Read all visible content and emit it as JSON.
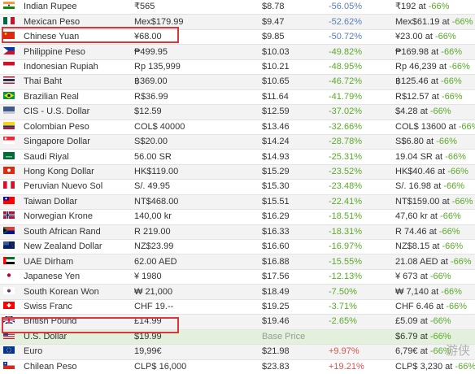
{
  "rows": [
    {
      "flag": "india",
      "name": "Indian Rupee",
      "price": "₹565",
      "converted": "$8.78",
      "diff": "-56.05%",
      "diff_type": "neg",
      "sale_price": "₹192",
      "sale_suffix": "at",
      "sale_pct": "-66%"
    },
    {
      "flag": "mexico",
      "name": "Mexican Peso",
      "price": "Mex$179.99",
      "converted": "$9.47",
      "diff": "-52.62%",
      "diff_type": "neg",
      "sale_price": "Mex$61.19",
      "sale_suffix": "at",
      "sale_pct": "-66%"
    },
    {
      "flag": "china",
      "name": "Chinese Yuan",
      "price": "¥68.00",
      "converted": "$9.85",
      "diff": "-50.72%",
      "diff_type": "neg",
      "sale_price": "¥23.00",
      "sale_suffix": "at",
      "sale_pct": "-66%"
    },
    {
      "flag": "philippines",
      "name": "Philippine Peso",
      "price": "₱499.95",
      "converted": "$10.03",
      "diff": "-49.82%",
      "diff_type": "green",
      "sale_price": "₱169.98",
      "sale_suffix": "at",
      "sale_pct": "-66%"
    },
    {
      "flag": "indonesia",
      "name": "Indonesian Rupiah",
      "price": "Rp 135,999",
      "converted": "$10.21",
      "diff": "-48.95%",
      "diff_type": "green",
      "sale_price": "Rp 46,239",
      "sale_suffix": "at",
      "sale_pct": "-66%"
    },
    {
      "flag": "thailand",
      "name": "Thai Baht",
      "price": "฿369.00",
      "converted": "$10.65",
      "diff": "-46.72%",
      "diff_type": "green",
      "sale_price": "฿125.46",
      "sale_suffix": "at",
      "sale_pct": "-66%"
    },
    {
      "flag": "brazil",
      "name": "Brazilian Real",
      "price": "R$36.99",
      "converted": "$11.64",
      "diff": "-41.79%",
      "diff_type": "green",
      "sale_price": "R$12.57",
      "sale_suffix": "at",
      "sale_pct": "-66%"
    },
    {
      "flag": "cis",
      "name": "CIS - U.S. Dollar",
      "price": "$12.59",
      "converted": "$12.59",
      "diff": "-37.02%",
      "diff_type": "green",
      "sale_price": "$4.28",
      "sale_suffix": "at",
      "sale_pct": "-66%"
    },
    {
      "flag": "colombia",
      "name": "Colombian Peso",
      "price": "COL$ 40000",
      "converted": "$13.46",
      "diff": "-32.66%",
      "diff_type": "green",
      "sale_price": "COL$ 13600",
      "sale_suffix": "at",
      "sale_pct": "-66%"
    },
    {
      "flag": "singapore",
      "name": "Singapore Dollar",
      "price": "S$20.00",
      "converted": "$14.24",
      "diff": "-28.78%",
      "diff_type": "green",
      "sale_price": "S$6.80",
      "sale_suffix": "at",
      "sale_pct": "-66%"
    },
    {
      "flag": "saudi",
      "name": "Saudi Riyal",
      "price": "56.00 SR",
      "converted": "$14.93",
      "diff": "-25.31%",
      "diff_type": "green",
      "sale_price": "19.04 SR",
      "sale_suffix": "at",
      "sale_pct": "-66%"
    },
    {
      "flag": "hongkong",
      "name": "Hong Kong Dollar",
      "price": "HK$119.00",
      "converted": "$15.29",
      "diff": "-23.52%",
      "diff_type": "green",
      "sale_price": "HK$40.46",
      "sale_suffix": "at",
      "sale_pct": "-66%"
    },
    {
      "flag": "peru",
      "name": "Peruvian Nuevo Sol",
      "price": "S/. 49.95",
      "converted": "$15.30",
      "diff": "-23.48%",
      "diff_type": "green",
      "sale_price": "S/. 16.98",
      "sale_suffix": "at",
      "sale_pct": "-66%"
    },
    {
      "flag": "taiwan",
      "name": "Taiwan Dollar",
      "price": "NT$468.00",
      "converted": "$15.51",
      "diff": "-22.41%",
      "diff_type": "green",
      "sale_price": "NT$159.00",
      "sale_suffix": "at",
      "sale_pct": "-66%"
    },
    {
      "flag": "norway",
      "name": "Norwegian Krone",
      "price": "140,00 kr",
      "converted": "$16.29",
      "diff": "-18.51%",
      "diff_type": "green",
      "sale_price": "47,60 kr",
      "sale_suffix": "at",
      "sale_pct": "-66%"
    },
    {
      "flag": "southafrica",
      "name": "South African Rand",
      "price": "R 219.00",
      "converted": "$16.33",
      "diff": "-18.31%",
      "diff_type": "green",
      "sale_price": "R 74.46",
      "sale_suffix": "at",
      "sale_pct": "-66%"
    },
    {
      "flag": "newzealand",
      "name": "New Zealand Dollar",
      "price": "NZ$23.99",
      "converted": "$16.60",
      "diff": "-16.97%",
      "diff_type": "green",
      "sale_price": "NZ$8.15",
      "sale_suffix": "at",
      "sale_pct": "-66%"
    },
    {
      "flag": "uae",
      "name": "UAE Dirham",
      "price": "62.00 AED",
      "converted": "$16.88",
      "diff": "-15.55%",
      "diff_type": "green",
      "sale_price": "21.08 AED",
      "sale_suffix": "at",
      "sale_pct": "-66%"
    },
    {
      "flag": "japan",
      "name": "Japanese Yen",
      "price": "¥ 1980",
      "converted": "$17.56",
      "diff": "-12.13%",
      "diff_type": "green",
      "sale_price": "¥ 673",
      "sale_suffix": "at",
      "sale_pct": "-66%"
    },
    {
      "flag": "korea",
      "name": "South Korean Won",
      "price": "₩ 21,000",
      "converted": "$18.49",
      "diff": "-7.50%",
      "diff_type": "green",
      "sale_price": "₩ 7,140",
      "sale_suffix": "at",
      "sale_pct": "-66%"
    },
    {
      "flag": "swiss",
      "name": "Swiss Franc",
      "price": "CHF 19.--",
      "converted": "$19.25",
      "diff": "-3.71%",
      "diff_type": "green",
      "sale_price": "CHF 6.46",
      "sale_suffix": "at",
      "sale_pct": "-66%"
    },
    {
      "flag": "uk",
      "name": "British Pound",
      "price": "£14.99",
      "converted": "$19.46",
      "diff": "-2.65%",
      "diff_type": "green",
      "sale_price": "£5.09",
      "sale_suffix": "at",
      "sale_pct": "-66%"
    },
    {
      "flag": "usa",
      "name": "U.S. Dollar",
      "price": "$19.99",
      "converted": "Base Price",
      "diff": "",
      "diff_type": "muted",
      "sale_price": "$6.79",
      "sale_suffix": "at",
      "sale_pct": "-66%"
    },
    {
      "flag": "eu",
      "name": "Euro",
      "price": "19,99€",
      "converted": "$21.98",
      "diff": "+9.97%",
      "diff_type": "pos",
      "sale_price": "6,79€",
      "sale_suffix": "at",
      "sale_pct": "-66%"
    },
    {
      "flag": "chile",
      "name": "Chilean Peso",
      "price": "CLP$ 16,000",
      "converted": "$23.83",
      "diff": "+19.21%",
      "diff_type": "pos",
      "sale_price": "CLP$ 3,230",
      "sale_suffix": "at",
      "sale_pct": "-66%"
    }
  ],
  "colors": {
    "negative": "#5a7fb8",
    "green": "#5aaa29",
    "positive": "#d9534f",
    "highlight": "#d9373a",
    "base_row": "#e2f0dc"
  },
  "watermark": "游侠"
}
